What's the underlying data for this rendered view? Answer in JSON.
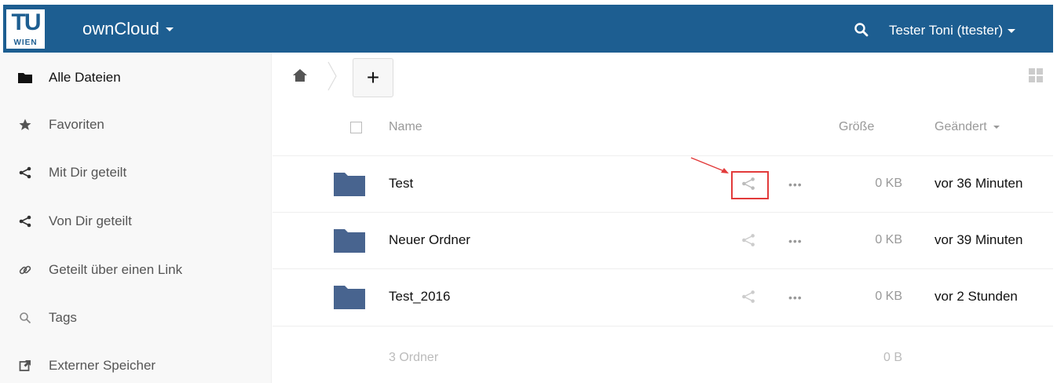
{
  "header": {
    "logo_top": "TU",
    "logo_bottom": "WIEN",
    "app_name": "ownCloud",
    "user_name": "Tester Toni (ttester)",
    "brand_color": "#1d5e91"
  },
  "sidebar": {
    "items": [
      {
        "label": "Alle Dateien",
        "icon": "folder-icon"
      },
      {
        "label": "Favoriten",
        "icon": "star-icon"
      },
      {
        "label": "Mit Dir geteilt",
        "icon": "share-icon"
      },
      {
        "label": "Von Dir geteilt",
        "icon": "share-icon"
      },
      {
        "label": "Geteilt über einen Link",
        "icon": "link-icon"
      },
      {
        "label": "Tags",
        "icon": "search-icon"
      },
      {
        "label": "Externer Speicher",
        "icon": "external-icon"
      }
    ]
  },
  "toolbar": {
    "new_label": "+"
  },
  "table": {
    "columns": {
      "name": "Name",
      "size": "Größe",
      "modified": "Geändert"
    },
    "rows": [
      {
        "name": "Test",
        "size": "0 KB",
        "modified": "vor 36 Minuten"
      },
      {
        "name": "Neuer Ordner",
        "size": "0 KB",
        "modified": "vor 39 Minuten"
      },
      {
        "name": "Test_2016",
        "size": "0 KB",
        "modified": "vor 2 Stunden"
      }
    ],
    "more_label": "•••",
    "summary": {
      "count": "3 Ordner",
      "size": "0 B"
    }
  },
  "annotation_color": "#e23a3a"
}
